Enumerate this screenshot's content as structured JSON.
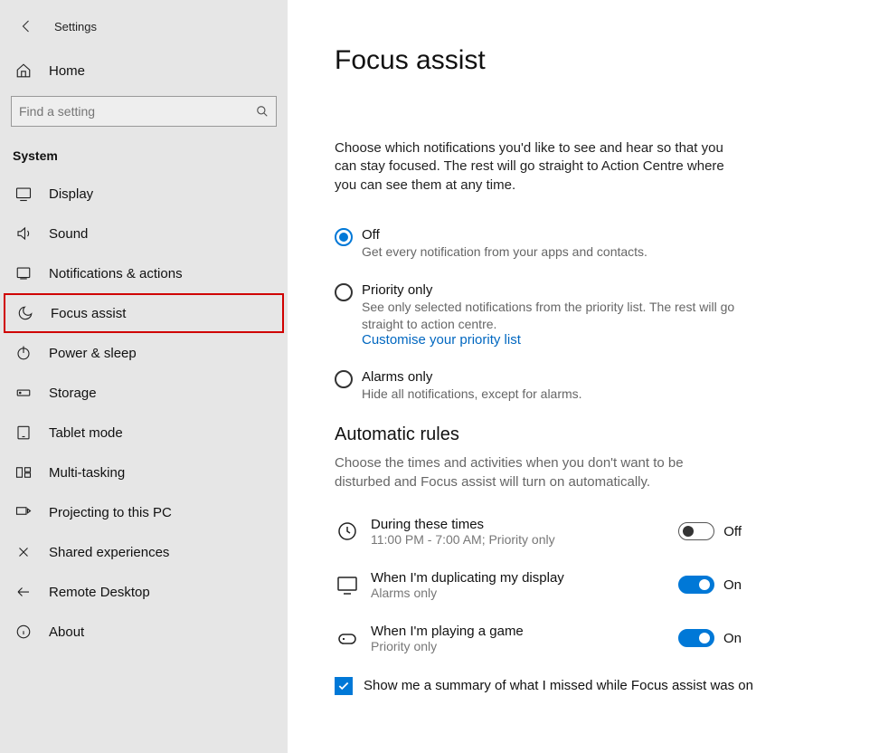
{
  "window": {
    "title": "Settings"
  },
  "sidebar": {
    "home_label": "Home",
    "search_placeholder": "Find a setting",
    "section_label": "System",
    "items": [
      {
        "label": "Display"
      },
      {
        "label": "Sound"
      },
      {
        "label": "Notifications & actions"
      },
      {
        "label": "Focus assist"
      },
      {
        "label": "Power & sleep"
      },
      {
        "label": "Storage"
      },
      {
        "label": "Tablet mode"
      },
      {
        "label": "Multi-tasking"
      },
      {
        "label": "Projecting to this PC"
      },
      {
        "label": "Shared experiences"
      },
      {
        "label": "Remote Desktop"
      },
      {
        "label": "About"
      }
    ]
  },
  "page": {
    "title": "Focus assist",
    "intro": "Choose which notifications you'd like to see and hear so that you can stay focused. The rest will go straight to Action Centre where you can see them at any time.",
    "options": {
      "off": {
        "title": "Off",
        "desc": "Get every notification from your apps and contacts."
      },
      "priority": {
        "title": "Priority only",
        "desc": "See only selected notifications from the priority list. The rest will go straight to action centre.",
        "link": "Customise your priority list"
      },
      "alarms": {
        "title": "Alarms only",
        "desc": "Hide all notifications, except for alarms."
      }
    },
    "auto": {
      "heading": "Automatic rules",
      "desc": "Choose the times and activities when you don't want to be disturbed and Focus assist will turn on automatically.",
      "rules": [
        {
          "title": "During these times",
          "sub": "11:00 PM - 7:00 AM; Priority only",
          "state": "Off",
          "on": false
        },
        {
          "title": "When I'm duplicating my display",
          "sub": "Alarms only",
          "state": "On",
          "on": true
        },
        {
          "title": "When I'm playing a game",
          "sub": "Priority only",
          "state": "On",
          "on": true
        }
      ],
      "summary_check_label": "Show me a summary of what I missed while Focus assist was on"
    }
  }
}
